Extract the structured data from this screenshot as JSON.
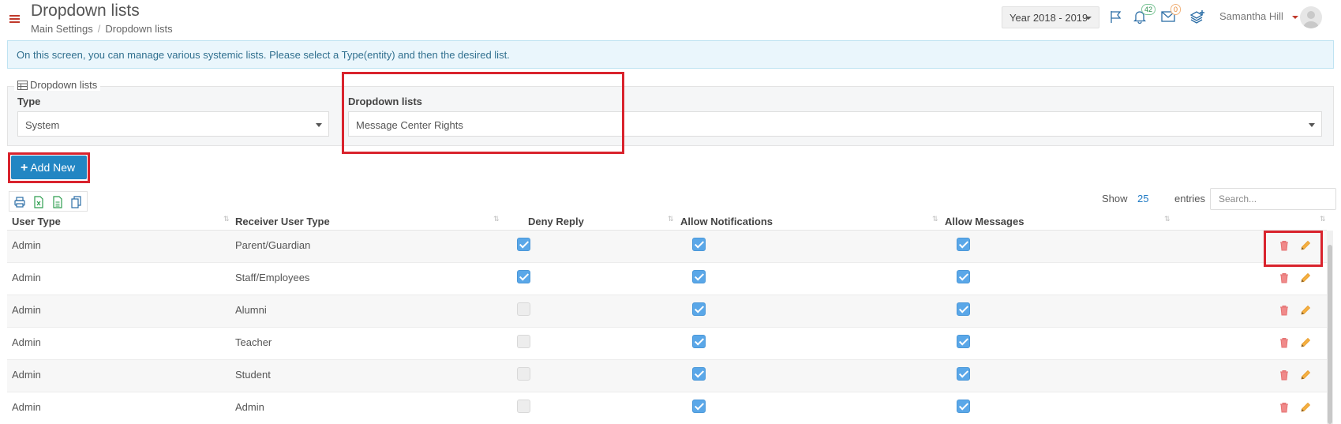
{
  "header": {
    "title": "Dropdown lists",
    "breadcrumb": [
      "Main Settings",
      "Dropdown lists"
    ],
    "year_selector": "Year 2018 - 2019",
    "notifications_count": "42",
    "messages_count": "0",
    "user_name": "Samantha Hill",
    "icons": [
      "menu-icon",
      "flag-icon",
      "bell-icon",
      "envelope-icon",
      "layers-add-icon",
      "avatar"
    ]
  },
  "info_message": "On this screen, you can manage various systemic lists. Please select a Type(entity) and then the desired list.",
  "filter": {
    "legend": "Dropdown lists",
    "type_label": "Type",
    "type_value": "System",
    "list_label": "Dropdown lists",
    "list_value": "Message Center Rights"
  },
  "toolbar": {
    "add_new_label": "Add New",
    "export_icons": [
      "print-icon",
      "excel-icon",
      "csv-icon",
      "copy-icon"
    ],
    "show_label": "Show",
    "show_value": "25",
    "entries_label": "entries",
    "search_placeholder": "Search..."
  },
  "table": {
    "columns": [
      "User Type",
      "Receiver User Type",
      "Deny Reply",
      "Allow Notifications",
      "Allow Messages",
      ""
    ],
    "rows": [
      {
        "user_type": "Admin",
        "receiver": "Parent/Guardian",
        "deny_reply": true,
        "allow_notifications": true,
        "allow_messages": true
      },
      {
        "user_type": "Admin",
        "receiver": "Staff/Employees",
        "deny_reply": true,
        "allow_notifications": true,
        "allow_messages": true
      },
      {
        "user_type": "Admin",
        "receiver": "Alumni",
        "deny_reply": false,
        "allow_notifications": true,
        "allow_messages": true
      },
      {
        "user_type": "Admin",
        "receiver": "Teacher",
        "deny_reply": false,
        "allow_notifications": true,
        "allow_messages": true
      },
      {
        "user_type": "Admin",
        "receiver": "Student",
        "deny_reply": false,
        "allow_notifications": true,
        "allow_messages": true
      },
      {
        "user_type": "Admin",
        "receiver": "Admin",
        "deny_reply": false,
        "allow_notifications": true,
        "allow_messages": true
      }
    ]
  },
  "colors": {
    "primary": "#2286c3",
    "highlight": "#d9232d",
    "checkbox": "#5aa7e8",
    "delete": "#e74c3c",
    "edit": "#f39c12",
    "info_bg": "#eaf6fc"
  }
}
